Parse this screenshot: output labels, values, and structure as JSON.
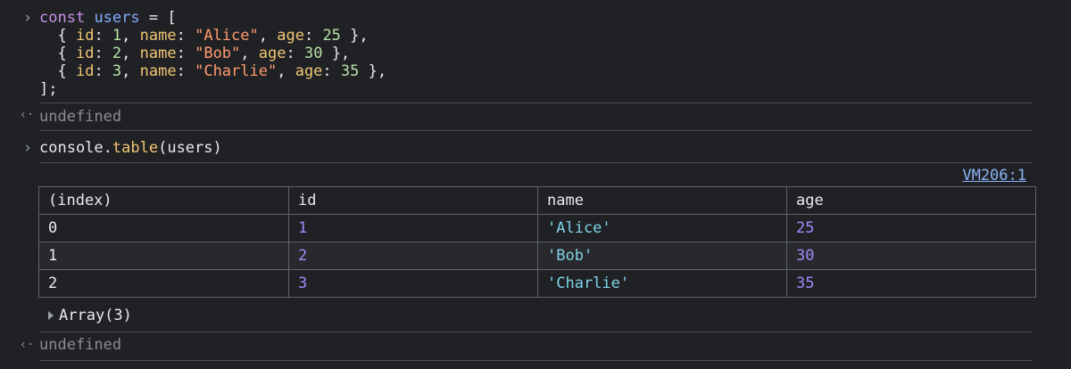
{
  "input1": {
    "prompt": "›",
    "code": {
      "kw_const": "const",
      "var_users": "users",
      "eq_open": " = [",
      "rows": [
        {
          "open": "  { ",
          "id_key": "id",
          "colon1": ": ",
          "id_val": "1",
          "sep1": ", ",
          "name_key": "name",
          "colon2": ": ",
          "name_val": "\"Alice\"",
          "sep2": ", ",
          "age_key": "age",
          "colon3": ": ",
          "age_val": "25",
          "close": " },"
        },
        {
          "open": "  { ",
          "id_key": "id",
          "colon1": ": ",
          "id_val": "2",
          "sep1": ", ",
          "name_key": "name",
          "colon2": ": ",
          "name_val": "\"Bob\"",
          "sep2": ", ",
          "age_key": "age",
          "colon3": ": ",
          "age_val": "30",
          "close": " },"
        },
        {
          "open": "  { ",
          "id_key": "id",
          "colon1": ": ",
          "id_val": "3",
          "sep1": ", ",
          "name_key": "name",
          "colon2": ": ",
          "name_val": "\"Charlie\"",
          "sep2": ", ",
          "age_key": "age",
          "colon3": ": ",
          "age_val": "35",
          "close": " },"
        }
      ],
      "close_line": "];"
    }
  },
  "result1": {
    "arrow": "‹·",
    "text": "undefined"
  },
  "input2": {
    "prompt": "›",
    "obj": "console",
    "dot": ".",
    "method": "table",
    "args": "(users)"
  },
  "source_link": "VM206:1",
  "table": {
    "headers": [
      "(index)",
      "id",
      "name",
      "age"
    ],
    "rows": [
      {
        "index": "0",
        "id": "1",
        "name": "'Alice'",
        "age": "25"
      },
      {
        "index": "1",
        "id": "2",
        "name": "'Bob'",
        "age": "30"
      },
      {
        "index": "2",
        "id": "3",
        "name": "'Charlie'",
        "age": "35"
      }
    ]
  },
  "array_label": "Array(3)",
  "result2": {
    "arrow": "‹·",
    "text": "undefined"
  },
  "colors": {
    "background": "#202124",
    "keyword": "#c792ea",
    "variable": "#82aaff",
    "property": "#f0c674",
    "string": "#ff9b6f",
    "number": "#b5e3a8",
    "link": "#8ab4f8",
    "table_number": "#9d8cfb",
    "table_string": "#7fd3e8"
  }
}
